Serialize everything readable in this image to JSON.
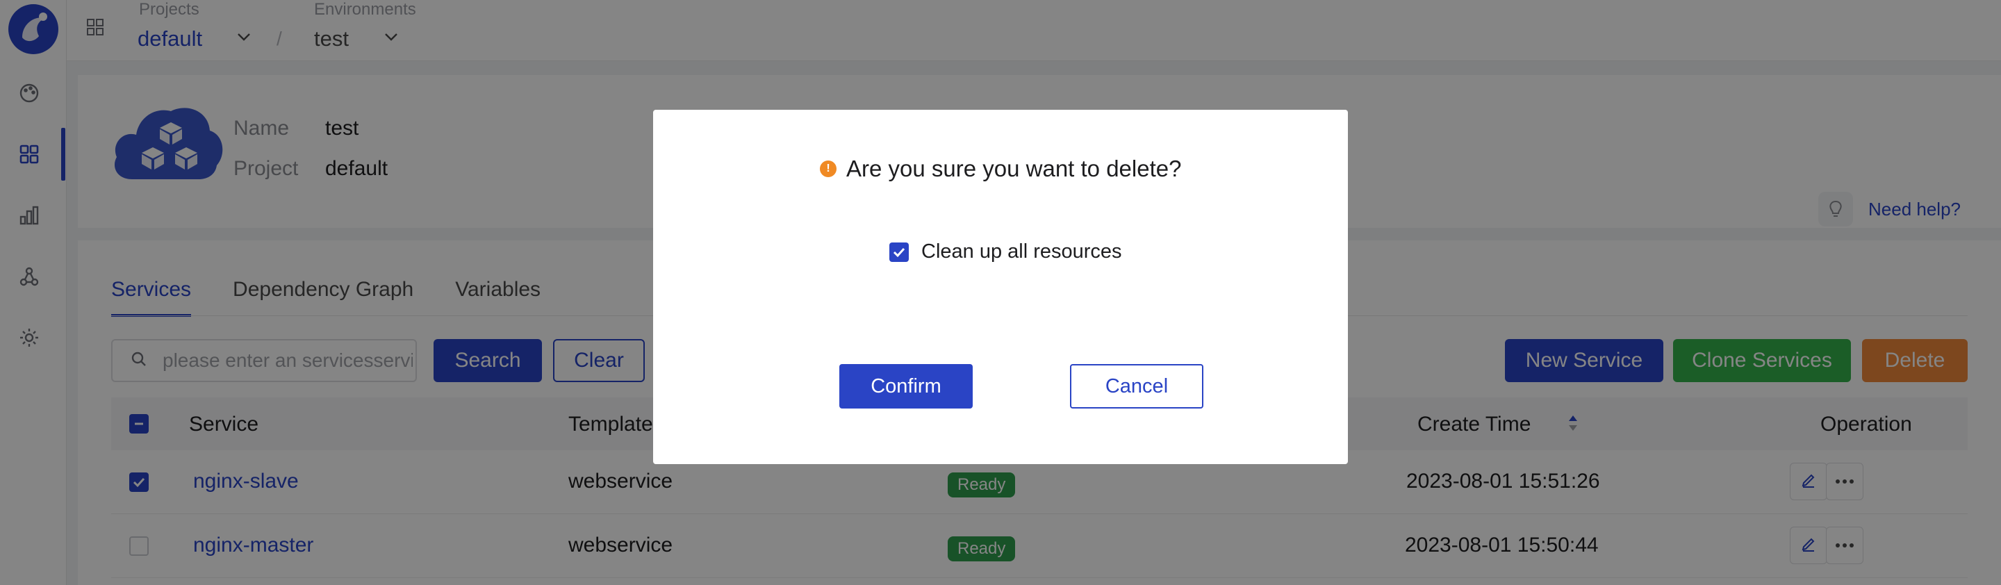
{
  "topbar": {
    "projects_label": "Projects",
    "project_value": "default",
    "separator": "/",
    "environments_label": "Environments",
    "environment_value": "test"
  },
  "sidebar": {
    "items": [
      {
        "icon": "palette-icon"
      },
      {
        "icon": "grid-icon",
        "active": true
      },
      {
        "icon": "bar-chart-icon"
      },
      {
        "icon": "cluster-icon"
      },
      {
        "icon": "gear-icon"
      }
    ]
  },
  "env_info": {
    "name_label": "Name",
    "name_value": "test",
    "project_label": "Project",
    "project_value": "default",
    "help_text": "Need help?"
  },
  "tabs": [
    {
      "label": "Services",
      "active": true
    },
    {
      "label": "Dependency Graph"
    },
    {
      "label": "Variables"
    }
  ],
  "toolbar": {
    "search_placeholder": "please enter an servicesservice",
    "search_label": "Search",
    "clear_label": "Clear",
    "new_service_label": "New Service",
    "clone_services_label": "Clone Services",
    "delete_label": "Delete"
  },
  "table": {
    "headers": {
      "service": "Service",
      "template": "Template",
      "create_time": "Create Time",
      "operation": "Operation"
    },
    "rows": [
      {
        "service": "nginx-slave",
        "template": "webservice",
        "status": "Ready",
        "create_time": "2023-08-01 15:51:26",
        "checked": true
      },
      {
        "service": "nginx-master",
        "template": "webservice",
        "status": "Ready",
        "create_time": "2023-08-01 15:50:44",
        "checked": false
      }
    ]
  },
  "modal": {
    "title": "Are you sure you want to delete?",
    "checkbox_label": "Clean up all resources",
    "checkbox_checked": true,
    "confirm_label": "Confirm",
    "cancel_label": "Cancel"
  },
  "colors": {
    "primary": "#2a44c5",
    "success": "#34b24c",
    "danger": "#f0893a",
    "warning_icon": "#f08a24",
    "ready_badge": "#2e9e4d"
  }
}
